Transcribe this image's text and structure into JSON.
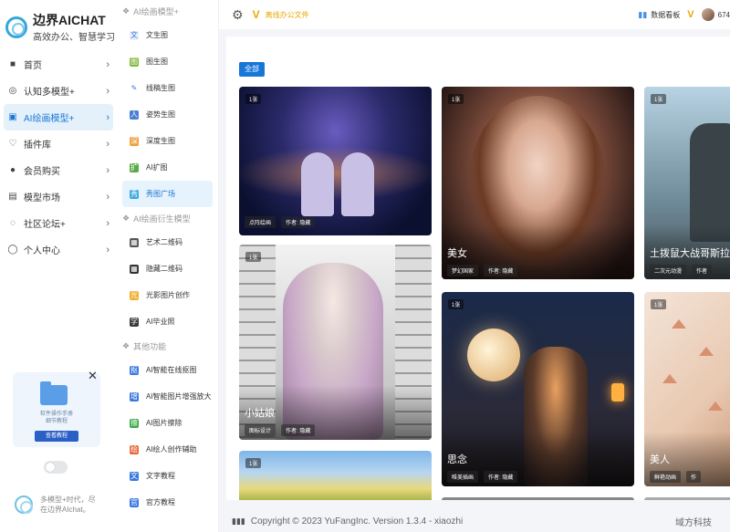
{
  "brand": {
    "name": "边界AICHAT",
    "tagline": "高效办公、智慧学习"
  },
  "nav": [
    {
      "icon": "home-icon",
      "glyph": "■",
      "label": "首页"
    },
    {
      "icon": "brain-icon",
      "glyph": "◎",
      "label": "认知多模型+"
    },
    {
      "icon": "image-icon",
      "glyph": "▣",
      "label": "AI绘画模型+",
      "active": true
    },
    {
      "icon": "plugin-icon",
      "glyph": "♡",
      "label": "插件库"
    },
    {
      "icon": "user-icon",
      "glyph": "●",
      "label": "会员购买"
    },
    {
      "icon": "market-icon",
      "glyph": "▤",
      "label": "模型市场"
    },
    {
      "icon": "forum-icon",
      "glyph": "◌",
      "label": "社区论坛+"
    },
    {
      "icon": "profile-icon",
      "glyph": "◯",
      "label": "个人中心"
    }
  ],
  "promo": {
    "line1": "软件操作手册",
    "line2": "细节教程",
    "button": "查看教程"
  },
  "side_footer": {
    "line1": "多模型+时代，尽",
    "line2": "在边界AIchat。"
  },
  "secondary": [
    {
      "type": "title",
      "label": "AI绘画模型+",
      "icon": "palette-icon"
    },
    {
      "type": "item",
      "label": "文生图",
      "icon": "text-image-icon",
      "color": "#e8eef8",
      "glyph": "文"
    },
    {
      "type": "item",
      "label": "图生图",
      "icon": "image-image-icon",
      "color": "#7fba3a",
      "glyph": "图"
    },
    {
      "type": "item",
      "label": "线稿生图",
      "icon": "sketch-icon",
      "color": "#ffffff",
      "glyph": "✎"
    },
    {
      "type": "item",
      "label": "姿势生图",
      "icon": "pose-icon",
      "color": "#4a7fd6",
      "glyph": "人"
    },
    {
      "type": "item",
      "label": "深度生图",
      "icon": "depth-icon",
      "color": "#f0a040",
      "glyph": "深"
    },
    {
      "type": "item",
      "label": "AI扩图",
      "icon": "expand-icon",
      "color": "#5aaa4a",
      "glyph": "扩"
    },
    {
      "type": "item",
      "label": "秀图广场",
      "icon": "gallery-icon",
      "color": "#3aaae0",
      "glyph": "秀",
      "active": true
    },
    {
      "type": "title",
      "label": "AI绘画衍生模型",
      "icon": "layers-icon"
    },
    {
      "type": "item",
      "label": "艺术二维码",
      "icon": "art-qr-icon",
      "color": "#555555",
      "glyph": "▦"
    },
    {
      "type": "item",
      "label": "隐藏二维码",
      "icon": "hidden-qr-icon",
      "color": "#333333",
      "glyph": "▦"
    },
    {
      "type": "item",
      "label": "光影图片创作",
      "icon": "light-icon",
      "color": "#f0b030",
      "glyph": "光"
    },
    {
      "type": "item",
      "label": "AI毕业照",
      "icon": "graduation-icon",
      "color": "#3a3a3a",
      "glyph": "学"
    },
    {
      "type": "title",
      "label": "其他功能",
      "icon": "more-icon"
    },
    {
      "type": "item",
      "label": "AI智能在线抠图",
      "icon": "cutout-icon",
      "color": "#3a7ae0",
      "glyph": "抠"
    },
    {
      "type": "item",
      "label": "AI智能图片增强放大",
      "icon": "enhance-icon",
      "color": "#3a7ae0",
      "glyph": "增"
    },
    {
      "type": "item",
      "label": "AI图片擦除",
      "icon": "erase-icon",
      "color": "#3aaa4a",
      "glyph": "擦"
    },
    {
      "type": "item",
      "label": "AI绘人创作辅助",
      "icon": "assist-icon",
      "color": "#e86a3a",
      "glyph": "绘"
    },
    {
      "type": "item",
      "label": "文字教程",
      "icon": "doc-icon",
      "color": "#3a7ae0",
      "glyph": "文"
    },
    {
      "type": "item",
      "label": "官方教程",
      "icon": "official-icon",
      "color": "#3a7ae0",
      "glyph": "官"
    }
  ],
  "header": {
    "office_label": "离线办公文件",
    "dashboard_label": "数据看板",
    "user_id": "674"
  },
  "content": {
    "filter_all": "全部",
    "cards": [
      {
        "badge": "1张",
        "title": "",
        "tags": [
          "点阵绘画",
          "作者: 隐藏"
        ]
      },
      {
        "badge": "1张",
        "title": "美女",
        "tags": [
          "梦幻国家",
          "作者: 隐藏"
        ]
      },
      {
        "badge": "1张",
        "title": "土拨鼠大战哥斯拉",
        "tags": [
          "二次元动漫",
          "作者"
        ]
      },
      {
        "badge": "1张",
        "title": "小姑娘",
        "tags": [
          "图标设计",
          "作者: 隐藏"
        ]
      },
      {
        "badge": "1张",
        "title": "",
        "tags": []
      },
      {
        "badge": "1张",
        "title": "思念",
        "tags": [
          "唯美插画",
          "作者: 隐藏"
        ]
      },
      {
        "badge": "1张",
        "title": "美人",
        "tags": [
          "鲜艳动画",
          "作"
        ]
      }
    ]
  },
  "footer": {
    "copyright": "Copyright © 2023 YuFangInc. Version 1.3.4 - xiaozhi",
    "company": "域方科技"
  }
}
